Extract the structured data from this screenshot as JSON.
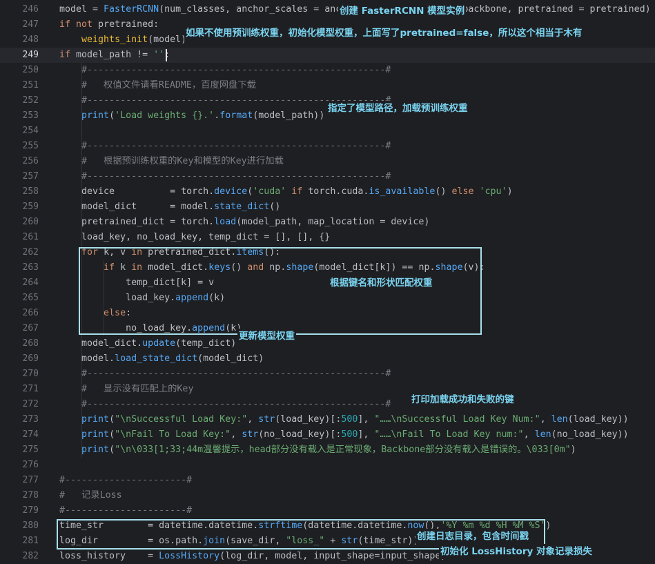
{
  "editor": {
    "lines": [
      {
        "n": "246",
        "html": "model = <span class='fn'>FasterRCNN</span>(num_classes, anchor_scales = anchors_size, backbone = backbone, pretrained = pretrained)"
      },
      {
        "n": "247",
        "html": "<span class='kw'>if not</span> pretrained:"
      },
      {
        "n": "248",
        "html": "    <span class='yel'>weights_init</span>(model)"
      },
      {
        "n": "249",
        "html": "<span class='kw'>if</span> model_path != <span class='str'>''</span>:"
      },
      {
        "n": "250",
        "html": "    <span class='cm'>#------------------------------------------------------#</span>"
      },
      {
        "n": "251",
        "html": "    <span class='cm'>#   权值文件请看README，百度网盘下载</span>"
      },
      {
        "n": "252",
        "html": "    <span class='cm'>#------------------------------------------------------#</span>"
      },
      {
        "n": "253",
        "html": "    <span class='fn'>print</span>(<span class='str'>'Load weights {}.'</span>.<span class='fn'>format</span>(model_path))"
      },
      {
        "n": "254",
        "html": ""
      },
      {
        "n": "255",
        "html": "    <span class='cm'>#------------------------------------------------------#</span>"
      },
      {
        "n": "256",
        "html": "    <span class='cm'>#   根据预训练权重的Key和模型的Key进行加载</span>"
      },
      {
        "n": "257",
        "html": "    <span class='cm'>#------------------------------------------------------#</span>"
      },
      {
        "n": "258",
        "html": "    device          = torch.<span class='fn'>device</span>(<span class='str'>'cuda'</span> <span class='kw'>if</span> torch.cuda.<span class='fn'>is_available</span>() <span class='kw'>else</span> <span class='str'>'cpu'</span>)"
      },
      {
        "n": "259",
        "html": "    model_dict      = model.<span class='fn'>state_dict</span>()"
      },
      {
        "n": "260",
        "html": "    pretrained_dict = torch.<span class='fn'>load</span>(model_path, map_location = device)"
      },
      {
        "n": "261",
        "html": "    load_key, no_load_key, temp_dict = [], [], {}"
      },
      {
        "n": "262",
        "html": "    <span class='kw'>for</span> k, v <span class='kw'>in</span> pretrained_dict.<span class='fn'>items</span>():"
      },
      {
        "n": "263",
        "html": "        <span class='kw'>if</span> k <span class='kw'>in</span> model_dict.<span class='fn'>keys</span>() <span class='kw'>and</span> np.<span class='fn'>shape</span>(model_dict[k]) == np.<span class='fn'>shape</span>(v):"
      },
      {
        "n": "264",
        "html": "            temp_dict[k] = v"
      },
      {
        "n": "265",
        "html": "            load_key.<span class='fn'>append</span>(k)"
      },
      {
        "n": "266",
        "html": "        <span class='kw'>else</span>:"
      },
      {
        "n": "267",
        "html": "            no_load_key.<span class='fn'>append</span>(k)"
      },
      {
        "n": "268",
        "html": "    model_dict.<span class='fn'>update</span>(temp_dict)"
      },
      {
        "n": "269",
        "html": "    model.<span class='fn'>load_state_dict</span>(model_dict)"
      },
      {
        "n": "270",
        "html": "    <span class='cm'>#------------------------------------------------------#</span>"
      },
      {
        "n": "271",
        "html": "    <span class='cm'>#   显示没有匹配上的Key</span>"
      },
      {
        "n": "272",
        "html": "    <span class='cm'>#------------------------------------------------------#</span>"
      },
      {
        "n": "273",
        "html": "    <span class='fn'>print</span>(<span class='str'>\"\\nSuccessful Load Key:\"</span>, <span class='fn'>str</span>(load_key)[:<span class='num'>500</span>], <span class='str'>\"……\\nSuccessful Load Key Num:\"</span>, <span class='fn'>len</span>(load_key))"
      },
      {
        "n": "274",
        "html": "    <span class='fn'>print</span>(<span class='str'>\"\\nFail To Load Key:\"</span>, <span class='fn'>str</span>(no_load_key)[:<span class='num'>500</span>], <span class='str'>\"……\\nFail To Load Key num:\"</span>, <span class='fn'>len</span>(no_load_key))"
      },
      {
        "n": "275",
        "html": "    <span class='fn'>print</span>(<span class='str'>\"\\n\\033[1;33;44m温馨提示，head部分没有载入是正常现象，Backbone部分没有载入是错误的。\\033[0m\"</span>)"
      },
      {
        "n": "276",
        "html": ""
      },
      {
        "n": "277",
        "html": "<span class='cm'>#----------------------#</span>"
      },
      {
        "n": "278",
        "html": "<span class='cm'>#   记录Loss</span>"
      },
      {
        "n": "279",
        "html": "<span class='cm'>#----------------------#</span>"
      },
      {
        "n": "280",
        "html": "time_str        = datetime.datetime.<span class='fn'>strftime</span>(datetime.datetime.<span class='fn'>now</span>(),<span class='str'>'%Y_%m_%d_%H_%M_%S'</span>)"
      },
      {
        "n": "281",
        "html": "log_dir         = os.path.<span class='fn'>join</span>(save_dir, <span class='str'>\"loss_\"</span> + <span class='fn'>str</span>(time_str))"
      },
      {
        "n": "282",
        "html": "loss_history    = <span class='fn'>LossHistory</span>(log_dir, model, input_shape=input_shape)"
      }
    ],
    "current_line": "249"
  },
  "annotations": {
    "a246": "创建 FasterRCNN 模型实例",
    "a248": "如果不使用预训练权重，初始化模型权重，上面写了pretrained=false，所以这个相当于木有",
    "a253": "指定了模型路径，加载预训练权重",
    "a265": "根据键名和形状匹配权重",
    "a268": "更新模型权重",
    "a272": "打印加载成功和失败的键",
    "a281": "创建日志目录，包含时间戳",
    "a282": "初始化 LossHistory 对象记录损失"
  }
}
